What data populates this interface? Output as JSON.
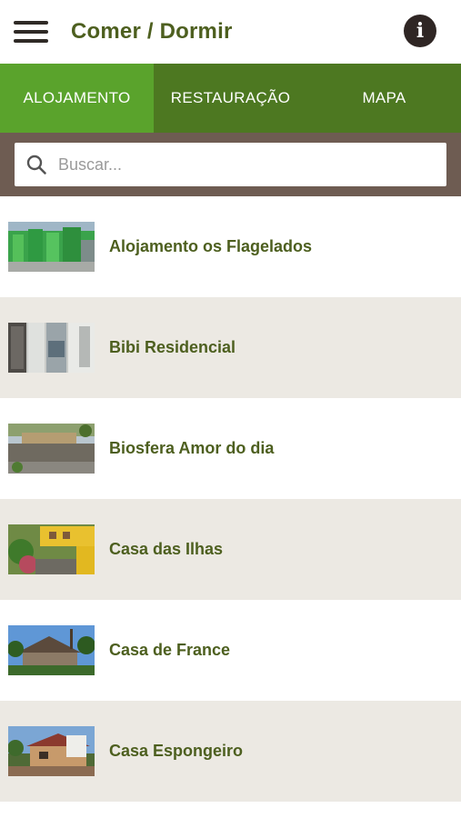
{
  "header": {
    "title": "Comer / Dormir",
    "menu_icon": "hamburger-menu-icon",
    "info_icon": "info-icon",
    "info_glyph": "i"
  },
  "tabs": [
    {
      "label": "ALOJAMENTO",
      "active": true
    },
    {
      "label": "RESTAURAÇÃO",
      "active": false
    },
    {
      "label": "MAPA",
      "active": false
    }
  ],
  "search": {
    "placeholder": "Buscar...",
    "value": "",
    "icon": "search-icon"
  },
  "items": [
    {
      "name": "Alojamento os Flagelados"
    },
    {
      "name": "Bibi Residencial"
    },
    {
      "name": "Biosfera Amor do dia"
    },
    {
      "name": "Casa das Ilhas"
    },
    {
      "name": "Casa de France"
    },
    {
      "name": "Casa Espongeiro"
    }
  ],
  "colors": {
    "title_green": "#4d5f1f",
    "tab_bar": "#4d7821",
    "tab_active": "#5aa32c",
    "search_bar": "#6e5c52",
    "alt_row": "#ece9e3"
  }
}
